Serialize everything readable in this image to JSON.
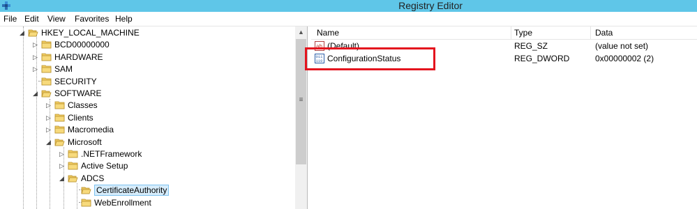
{
  "window": {
    "title": "Registry Editor"
  },
  "menu": [
    "File",
    "Edit",
    "View",
    "Favorites",
    "Help"
  ],
  "tree": [
    {
      "label": "HKEY_LOCAL_MACHINE",
      "state": "expanded"
    },
    {
      "label": "BCD00000000",
      "state": "collapsed"
    },
    {
      "label": "HARDWARE",
      "state": "collapsed"
    },
    {
      "label": "SAM",
      "state": "collapsed"
    },
    {
      "label": "SECURITY",
      "state": "leaf"
    },
    {
      "label": "SOFTWARE",
      "state": "expanded"
    },
    {
      "label": "Classes",
      "state": "collapsed"
    },
    {
      "label": "Clients",
      "state": "collapsed"
    },
    {
      "label": "Macromedia",
      "state": "collapsed"
    },
    {
      "label": "Microsoft",
      "state": "expanded"
    },
    {
      "label": ".NETFramework",
      "state": "collapsed"
    },
    {
      "label": "Active Setup",
      "state": "collapsed"
    },
    {
      "label": "ADCS",
      "state": "expanded"
    },
    {
      "label": "CertificateAuthority",
      "state": "selected"
    },
    {
      "label": "WebEnrollment",
      "state": "leaf"
    }
  ],
  "list": {
    "columns": [
      "Name",
      "Type",
      "Data"
    ],
    "rows": [
      {
        "name": "(Default)",
        "type": "REG_SZ",
        "data": "(value not set)",
        "icon": "string-value-icon"
      },
      {
        "name": "ConfigurationStatus",
        "type": "REG_DWORD",
        "data": "0x00000002 (2)",
        "icon": "binary-value-icon"
      }
    ]
  },
  "colors": {
    "titlebar": "#5fc6e8",
    "highlight": "#e4141e",
    "selection": "#d6ecfb"
  }
}
